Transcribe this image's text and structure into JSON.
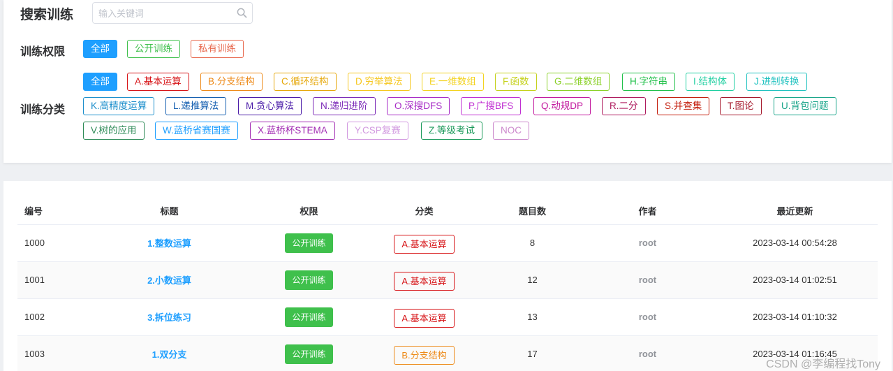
{
  "header": {
    "title": "搜索训练",
    "search_placeholder": "输入关键词",
    "search_icon": "search-icon"
  },
  "permission": {
    "label": "训练权限",
    "items": [
      {
        "label": "全部",
        "color": "#1e9fff",
        "active": true
      },
      {
        "label": "公开训练",
        "color": "#3fc04c",
        "active": false
      },
      {
        "label": "私有训练",
        "color": "#e8694e",
        "active": false
      }
    ]
  },
  "category": {
    "label": "训练分类",
    "items": [
      {
        "label": "全部",
        "color": "#1e9fff",
        "active": true
      },
      {
        "label": "A.基本运算",
        "color": "#d71518"
      },
      {
        "label": "B.分支结构",
        "color": "#ed8a19"
      },
      {
        "label": "C.循环结构",
        "color": "#e6a80b"
      },
      {
        "label": "D.穷举算法",
        "color": "#f6c71f"
      },
      {
        "label": "E.一维数组",
        "color": "#f3d320"
      },
      {
        "label": "F.函数",
        "color": "#c5d11b"
      },
      {
        "label": "G.二维数组",
        "color": "#8bd129"
      },
      {
        "label": "H.字符串",
        "color": "#21c04a"
      },
      {
        "label": "I.结构体",
        "color": "#1fcfa1"
      },
      {
        "label": "J.进制转换",
        "color": "#21c2c0"
      },
      {
        "label": "K.高精度运算",
        "color": "#1d8fcc"
      },
      {
        "label": "L.递推算法",
        "color": "#155fb0"
      },
      {
        "label": "M.贪心算法",
        "color": "#4a1ba8"
      },
      {
        "label": "N.递归进阶",
        "color": "#7b2ab7"
      },
      {
        "label": "O.深搜DFS",
        "color": "#a72bc6"
      },
      {
        "label": "P.广搜BFS",
        "color": "#c02ed2"
      },
      {
        "label": "Q.动规DP",
        "color": "#c2199e"
      },
      {
        "label": "R.二分",
        "color": "#ae1a5d"
      },
      {
        "label": "S.并查集",
        "color": "#c41e0d"
      },
      {
        "label": "T.图论",
        "color": "#a5182b"
      },
      {
        "label": "U.背包问题",
        "color": "#1aa58a"
      },
      {
        "label": "V.树的应用",
        "color": "#2e8b57"
      },
      {
        "label": "W.蓝桥省赛国赛",
        "color": "#1e9fff"
      },
      {
        "label": "X.蓝桥杯STEMA",
        "color": "#a22bb3"
      },
      {
        "label": "Y.CSP复赛",
        "color": "#d29ae0"
      },
      {
        "label": "Z.等级考试",
        "color": "#1b9a5a"
      },
      {
        "label": "NOC",
        "color": "#cc88cc"
      }
    ]
  },
  "table": {
    "columns": [
      "编号",
      "标题",
      "权限",
      "分类",
      "题目数",
      "作者",
      "最近更新"
    ],
    "rows": [
      {
        "id": "1000",
        "title": "1.整数运算",
        "permission": "公开训练",
        "category": "A.基本运算",
        "category_color": "#d71518",
        "count": "8",
        "author": "root",
        "updated": "2023-03-14 00:54:28"
      },
      {
        "id": "1001",
        "title": "2.小数运算",
        "permission": "公开训练",
        "category": "A.基本运算",
        "category_color": "#d71518",
        "count": "12",
        "author": "root",
        "updated": "2023-03-14 01:02:51"
      },
      {
        "id": "1002",
        "title": "3.拆位练习",
        "permission": "公开训练",
        "category": "A.基本运算",
        "category_color": "#d71518",
        "count": "13",
        "author": "root",
        "updated": "2023-03-14 01:10:32"
      },
      {
        "id": "1003",
        "title": "1.双分支",
        "permission": "公开训练",
        "category": "B.分支结构",
        "category_color": "#ed8a19",
        "count": "17",
        "author": "root",
        "updated": "2023-03-14 01:16:45"
      }
    ]
  },
  "watermark": "CSDN @李编程找Tony"
}
